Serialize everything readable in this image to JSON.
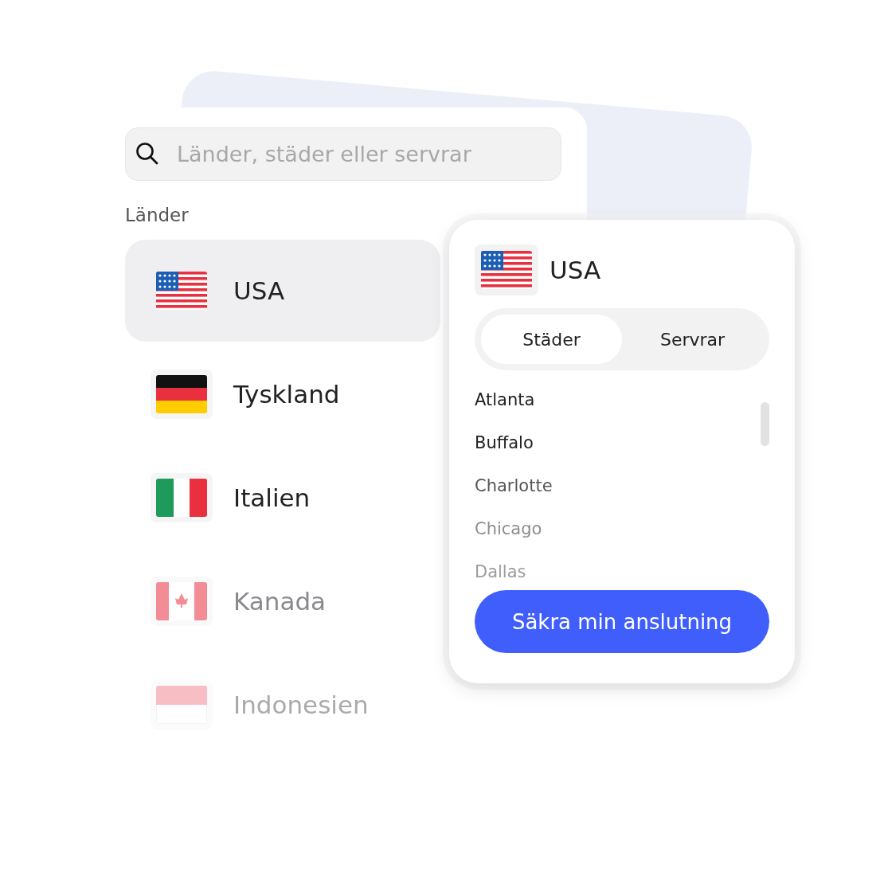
{
  "search": {
    "placeholder": "Länder, städer eller servrar"
  },
  "section_title": "Länder",
  "countries": [
    {
      "name": "USA",
      "kind": "us",
      "selected": true
    },
    {
      "name": "Tyskland",
      "kind": "de",
      "selected": false
    },
    {
      "name": "Italien",
      "kind": "it",
      "selected": false
    },
    {
      "name": "Kanada",
      "kind": "ca",
      "selected": false
    },
    {
      "name": "Indonesien",
      "kind": "id",
      "selected": false
    }
  ],
  "popup": {
    "country": "USA",
    "kind": "us",
    "tabs": [
      {
        "label": "Städer",
        "selected": true
      },
      {
        "label": "Servrar",
        "selected": false
      }
    ],
    "cities": [
      "Atlanta",
      "Buffalo",
      "Charlotte",
      "Chicago",
      "Dallas"
    ],
    "button": "Säkra min anslutning"
  }
}
